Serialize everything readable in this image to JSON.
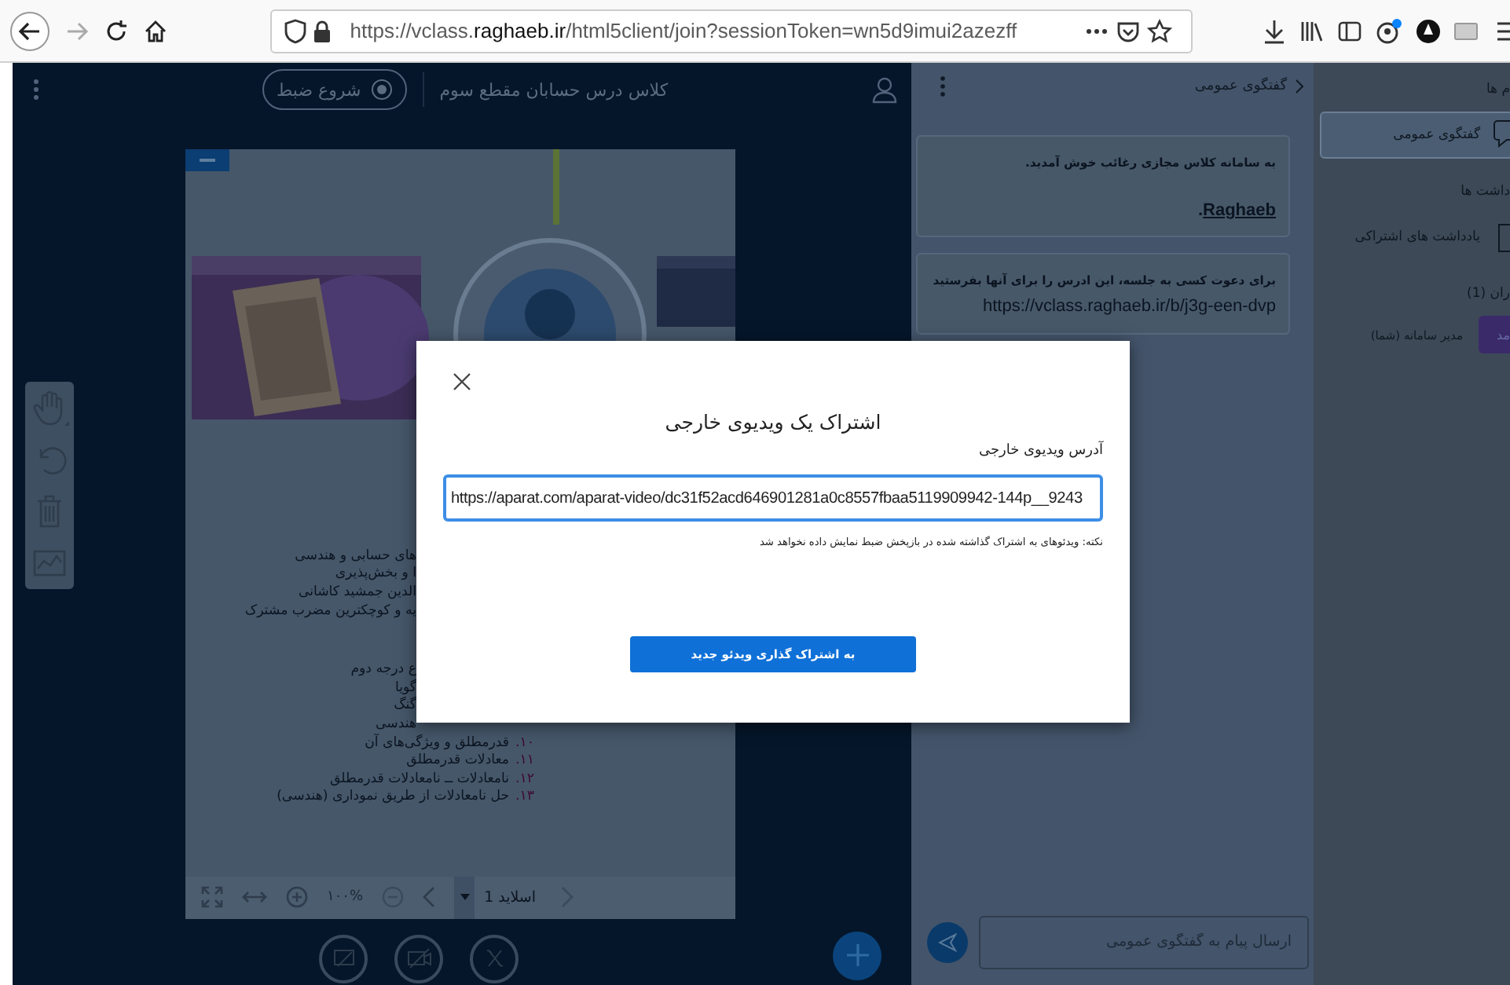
{
  "browser": {
    "url": "https://vclass.**raghaeb.ir**/html5client/join?sessionToken=wn5d9imui2azezff"
  },
  "app": {
    "title": "کلاس درس حسابان مقطع سوم",
    "record_button": "شروع ضبط"
  },
  "slide": {
    "blocks": [
      {
        "lines": [
          {
            "text": "های حسابی و هندسی",
            "kind": "cut"
          },
          {
            "text": "ا و بخش‌پذیری",
            "kind": "cut"
          },
          {
            "text": "الدین جمشید کاشانی",
            "kind": "cut"
          },
          {
            "text": "یه و کوچکترین مضرب مشترک",
            "kind": "cut"
          }
        ]
      },
      {
        "lines": [
          {
            "text": "ع درجه دوم",
            "kind": "cut"
          },
          {
            "text": "گویا",
            "kind": "cut"
          },
          {
            "text": "گنگ",
            "kind": "cut"
          },
          {
            "text": "هندسی",
            "kind": "cut"
          },
          {
            "number": "۱۰.",
            "text": "قدرمطلق و ویژگی‌های آن",
            "kind": "full"
          },
          {
            "number": "۱۱.",
            "text": "معادلات قدرمطلق",
            "kind": "full"
          },
          {
            "number": "۱۲.",
            "text": "نامعادلات ــ نامعادلات قدرمطلق",
            "kind": "full"
          },
          {
            "number": "۱۳.",
            "text": "حل نامعادلات از طریق نموداری (هندسی)",
            "kind": "full"
          }
        ]
      }
    ],
    "zoom": "۱۰۰%",
    "slide_label": "اسلاید 1"
  },
  "chat": {
    "title": "گفتگوی عمومی",
    "messages": [
      {
        "lines": [
          "به سامانه کلاس مجازی رغائب خوش آمدید."
        ],
        "link": "Raghaeb",
        "link_suffix": "."
      },
      {
        "lines": [
          "برای دعوت کسی به جلسه، این ادرس را برای آنها بفرستید",
          "https://vclass.raghaeb.ir/b/j3g-een-dvp"
        ]
      }
    ],
    "input": {
      "placeholder": "ارسال پیام به گفتگوی عمومی"
    }
  },
  "sidebar": {
    "items": [
      {
        "kind": "heading",
        "label": "م ها"
      },
      {
        "kind": "item",
        "label": "گفتگوی عمومی",
        "selected": true
      },
      {
        "kind": "heading",
        "label": "داشت ها"
      },
      {
        "kind": "item",
        "label": "یادداشت های اشتراکی",
        "selected": false
      },
      {
        "kind": "users-heading",
        "label": "ران (1)"
      },
      {
        "kind": "user",
        "avatar": "مد",
        "label": "مدیر سامانه (شما)"
      }
    ]
  },
  "modal": {
    "title": "اشتراک یک ویدیوی خارجی",
    "field_label": "آدرس ویدیوی خارجی",
    "field_value": "https://aparat.com/aparat-video/dc31f52acd646901281a0c8557fbaa5119909942-144p__9243",
    "note": "نکته: ویدئوهای به اشتراک گذاشته شده در بازپخش ضبط نمایش داده نخواهد شد",
    "button": "به اشتراک گذاری ویدئو جدید"
  }
}
